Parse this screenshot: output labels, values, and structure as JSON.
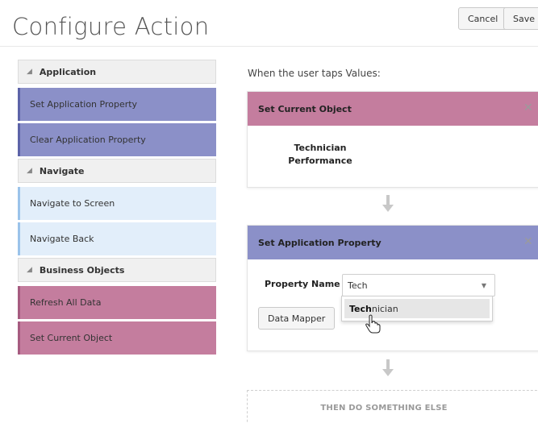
{
  "header": {
    "title": "Configure Action",
    "cancel_label": "Cancel",
    "save_label": "Save"
  },
  "sidebar": {
    "sections": [
      {
        "label": "Application",
        "items": [
          "Set Application Property",
          "Clear Application Property"
        ]
      },
      {
        "label": "Navigate",
        "items": [
          "Navigate to Screen",
          "Navigate Back"
        ]
      },
      {
        "label": "Business Objects",
        "items": [
          "Refresh All Data",
          "Set Current Object"
        ]
      }
    ]
  },
  "main": {
    "trigger_text": "When the user taps Values:",
    "card1": {
      "title": "Set Current Object",
      "object_line1": "Technician",
      "object_line2": "Performance"
    },
    "card2": {
      "title": "Set Application Property",
      "property_label": "Property Name",
      "property_value": "Tech",
      "data_mapper_label": "Data Mapper",
      "suggestion_match": "Tech",
      "suggestion_rest": "nician"
    },
    "then_label": "THEN DO SOMETHING ELSE"
  },
  "colors": {
    "application": "#8b90c8",
    "navigate": "#e2eefa",
    "business_objects": "#c47d9e"
  },
  "icons": [
    "collapse-triangle-icon",
    "close-icon",
    "dropdown-caret-icon",
    "down-arrow-icon",
    "hand-pointer-icon"
  ]
}
